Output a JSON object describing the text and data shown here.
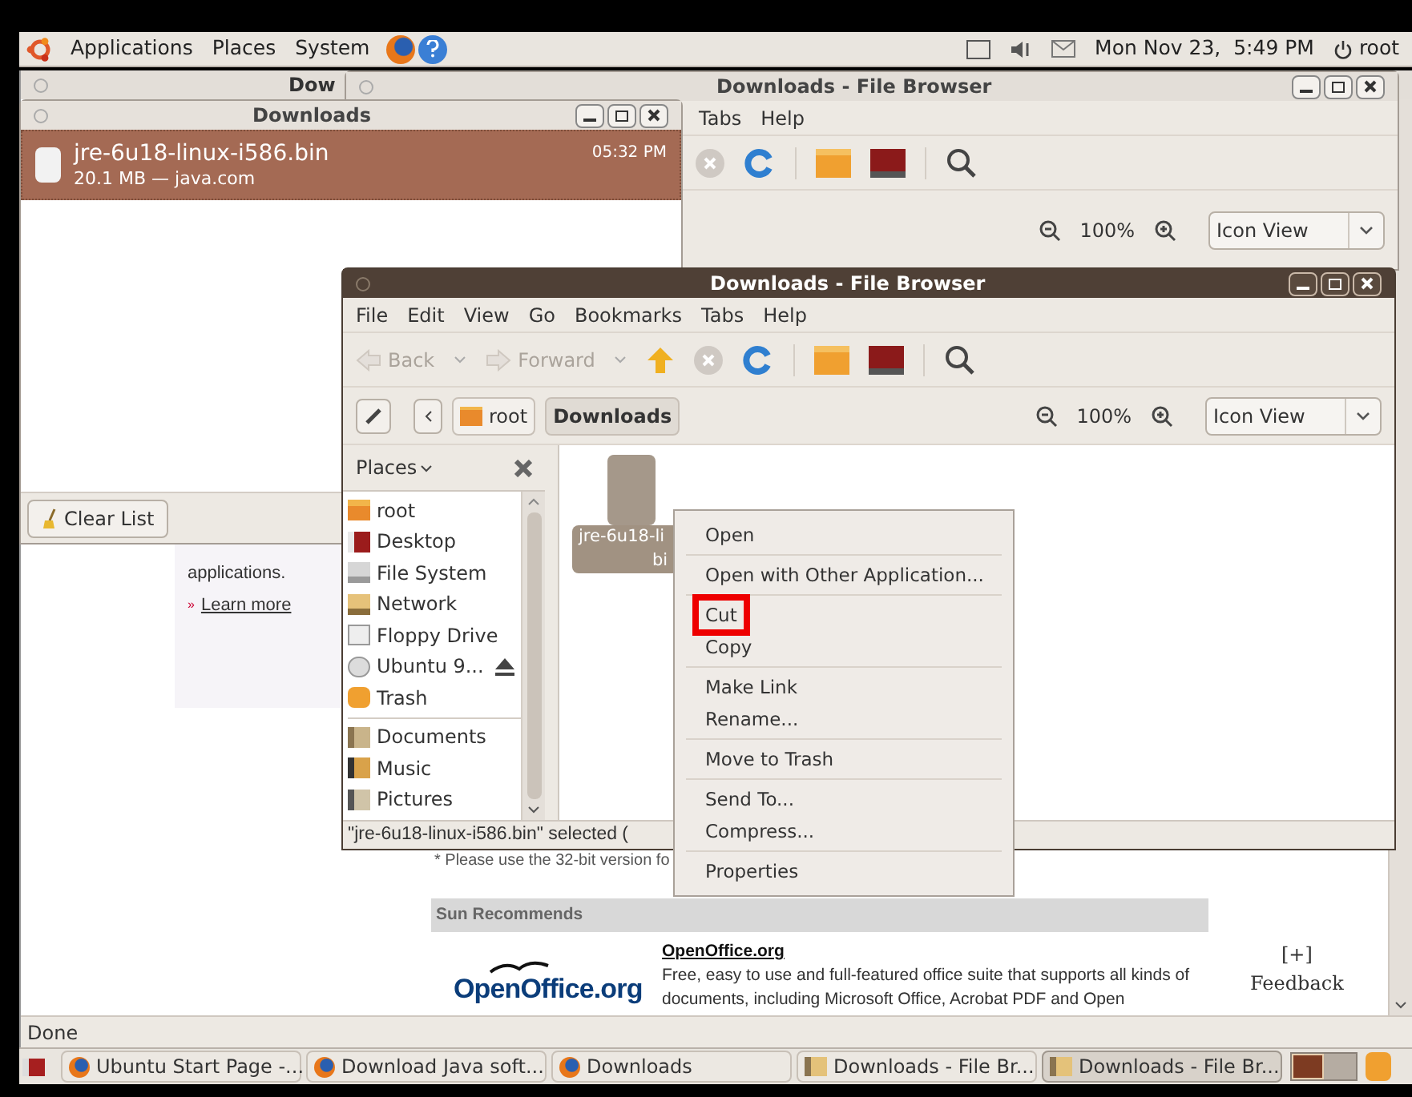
{
  "top_panel": {
    "menus": [
      "Applications",
      "Places",
      "System"
    ],
    "clock": "Mon Nov 23,  5:49 PM",
    "user": "root"
  },
  "browser_window": {
    "title": "Dow",
    "status": "Done",
    "page": {
      "intro": "applications.",
      "bullet": "»",
      "learn_more": "Learn more",
      "note": "* Please use the 32-bit version fo",
      "section": "Sun Recommends",
      "logo": "OpenOffice.org",
      "product_link": "OpenOffice.org",
      "product_text": "Free, easy to use and full-featured office suite that supports all kinds of documents, including Microsoft Office, Acrobat PDF and Open",
      "feedback_mark": "[+]",
      "feedback": "Feedback"
    }
  },
  "back_file_browser": {
    "title": "Downloads - File Browser",
    "menus": [
      "Tabs",
      "Help"
    ],
    "zoom": "100%",
    "view": "Icon View"
  },
  "downloads_window": {
    "title": "Downloads",
    "items": [
      {
        "name": "jre-6u18-linux-i586.bin",
        "detail": "20.1 MB — java.com",
        "time": "05:32 PM",
        "selected": true
      }
    ],
    "clear_button": "Clear List"
  },
  "file_browser": {
    "title": "Downloads - File Browser",
    "menus": [
      "File",
      "Edit",
      "View",
      "Go",
      "Bookmarks",
      "Tabs",
      "Help"
    ],
    "back": "Back",
    "forward": "Forward",
    "path": [
      {
        "label": "root",
        "selected": false
      },
      {
        "label": "Downloads",
        "selected": true
      }
    ],
    "zoom": "100%",
    "view": "Icon View",
    "sidebar_title": "Places",
    "places": [
      [
        {
          "label": "root",
          "kind": "home"
        },
        {
          "label": "Desktop",
          "kind": "desktop"
        },
        {
          "label": "File System",
          "kind": "drive"
        },
        {
          "label": "Network",
          "kind": "network"
        },
        {
          "label": "Floppy Drive",
          "kind": "floppy"
        },
        {
          "label": "Ubuntu 9...",
          "kind": "disc",
          "eject": true
        },
        {
          "label": "Trash",
          "kind": "trash"
        }
      ],
      [
        {
          "label": "Documents",
          "kind": "documents"
        },
        {
          "label": "Music",
          "kind": "music"
        },
        {
          "label": "Pictures",
          "kind": "pictures"
        }
      ]
    ],
    "file": {
      "lines": [
        "jre-6u18-li",
        "bi"
      ],
      "selected": true
    },
    "status": "\"jre-6u18-linux-i586.bin\" selected ("
  },
  "context_menu": [
    [
      {
        "label": "Open",
        "highlighted": false
      }
    ],
    [
      {
        "label": "Open with Other Application...",
        "highlighted": false
      }
    ],
    [
      {
        "label": "Cut",
        "highlighted": true
      },
      {
        "label": "Copy",
        "highlighted": false
      }
    ],
    [
      {
        "label": "Make Link",
        "highlighted": false
      },
      {
        "label": "Rename...",
        "highlighted": false
      }
    ],
    [
      {
        "label": "Move to Trash",
        "highlighted": false
      }
    ],
    [
      {
        "label": "Send To...",
        "highlighted": false
      },
      {
        "label": "Compress...",
        "highlighted": false
      }
    ],
    [
      {
        "label": "Properties",
        "highlighted": false
      }
    ]
  ],
  "taskbar": [
    {
      "label": "Ubuntu Start Page -...",
      "kind": "web",
      "selected": false
    },
    {
      "label": "Download Java soft...",
      "kind": "web",
      "selected": false
    },
    {
      "label": "Downloads",
      "kind": "web",
      "selected": false
    },
    {
      "label": "Downloads - File Br...",
      "kind": "folder",
      "selected": false
    },
    {
      "label": "Downloads - File Br...",
      "kind": "folder",
      "selected": true
    }
  ]
}
